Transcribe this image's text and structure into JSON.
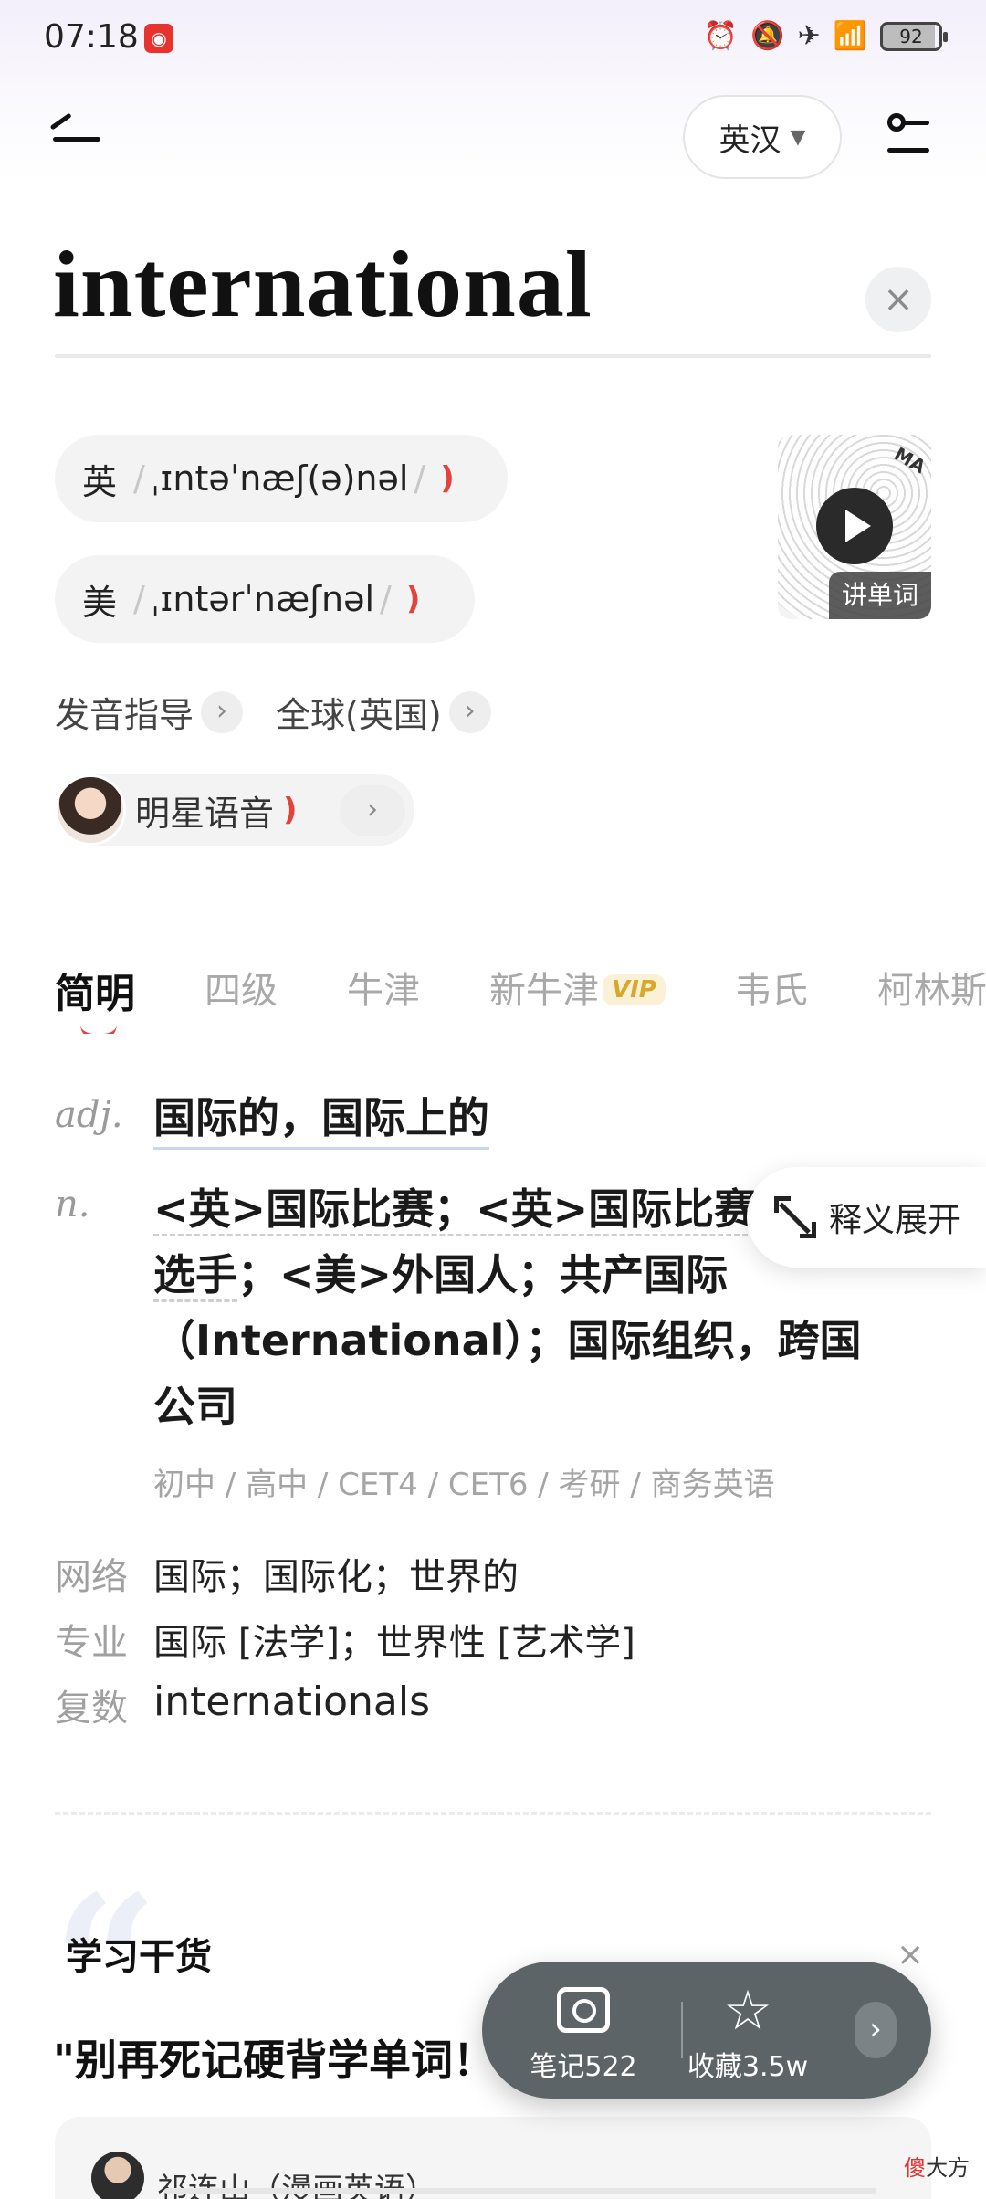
{
  "status": {
    "time": "07:18",
    "battery": "92",
    "icons": [
      "alarm-icon",
      "mute-icon",
      "airplane-icon",
      "wifi-icon"
    ]
  },
  "header": {
    "lang_label": "英汉"
  },
  "search": {
    "word": "international",
    "clear": "×"
  },
  "pronunciation": {
    "uk": {
      "region": "英",
      "ipa": "ˌɪntəˈnæʃ(ə)nəl"
    },
    "us": {
      "region": "美",
      "ipa": "ˌɪntərˈnæʃnəl"
    },
    "slash": "/",
    "speaker": ")"
  },
  "video": {
    "label": "讲单词",
    "corner_text": "MA"
  },
  "links": {
    "guide": "发音指导",
    "global": "全球(英国)",
    "celebrity": "明星语音"
  },
  "tabs": [
    {
      "label": "简明"
    },
    {
      "label": "四级"
    },
    {
      "label": "牛津"
    },
    {
      "label": "新牛津",
      "badge": "VIP"
    },
    {
      "label": "韦氏"
    },
    {
      "label": "柯林斯"
    }
  ],
  "definitions": {
    "adj_pos": "adj.",
    "adj": "国际的，国际上的",
    "n_pos": "n.",
    "n_parts": [
      "<英>国际比赛；<英>国际比赛",
      "选手",
      "；<美>外国人；共产国际（International）；国际组织，跨国公司"
    ],
    "levels": "初中 / 高中 / CET4 / CET6 / 考研 / 商务英语",
    "web_label": "网络",
    "web": "国际；国际化；世界的",
    "pro_label": "专业",
    "pro": "国际 [法学]；世界性 [艺术学]",
    "plural_label": "复数",
    "plural": "internationals",
    "expand": "释义展开"
  },
  "study": {
    "title": "学习干货",
    "close": "×",
    "headline": "\"别再死记硬背学单词！",
    "author": "祁连山（漫画英语）"
  },
  "actions": {
    "note_label": "笔记522",
    "fav_label": "收藏3.5w",
    "more": "›"
  },
  "watermark": {
    "red": "傻",
    "rest": "大方"
  },
  "colors": {
    "accent": "#e8403a",
    "vip": "#d8a82a",
    "action_bar": "#5c6467"
  }
}
